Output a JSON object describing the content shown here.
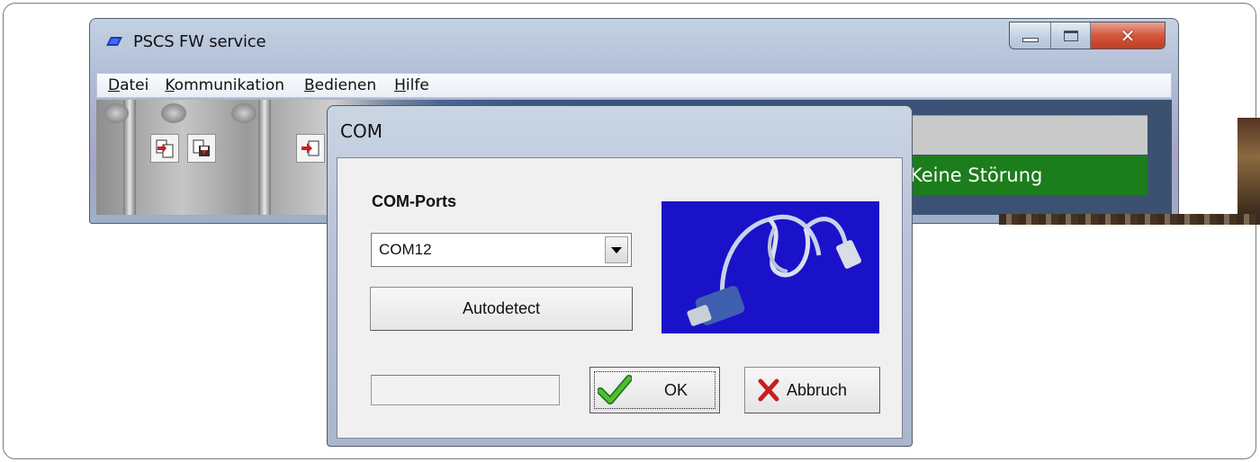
{
  "main_window": {
    "title": "PSCS FW service",
    "menu": [
      {
        "accel": "D",
        "rest": "atei"
      },
      {
        "accel": "K",
        "rest": "ommunikation"
      },
      {
        "accel": "B",
        "rest": "edienen"
      },
      {
        "accel": "H",
        "rest": "ilfe"
      }
    ],
    "status_text": "Keine Störung",
    "status_color": "#1b7d1b"
  },
  "dialog": {
    "title": "COM",
    "ports_label": "COM-Ports",
    "port_selected": "COM12",
    "autodetect_label": "Autodetect",
    "ok_label": "OK",
    "cancel_label": "Abbruch"
  },
  "icons": {
    "app": "app-logo-icon",
    "ok": "checkmark-icon",
    "cancel": "red-x-icon",
    "dropdown": "chevron-down-icon"
  }
}
